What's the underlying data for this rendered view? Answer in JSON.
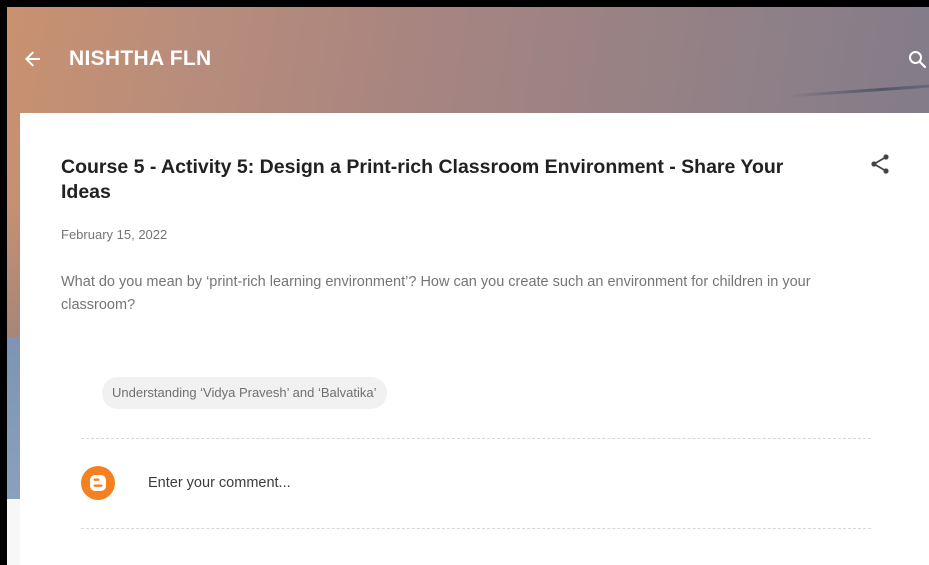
{
  "header": {
    "site_title": "NISHTHA FLN",
    "back_icon": "arrow-left-icon",
    "search_icon": "search-icon"
  },
  "post": {
    "title": "Course 5 - Activity 5: Design a Print-rich Classroom Environment - Share Your Ideas",
    "date": "February 15, 2022",
    "body": "What do you mean by ‘print-rich learning environment’? How can you create such an environment for children in your classroom?",
    "share_icon": "share-icon",
    "labels": [
      "Understanding ‘Vidya Pravesh’ and ‘Balvatika’"
    ]
  },
  "comments": {
    "placeholder": "Enter your comment...",
    "avatar_icon": "blogger-icon",
    "avatar_color": "#f48120"
  },
  "colors": {
    "title_text": "#212121",
    "meta_text": "#757575",
    "chip_bg": "#f1f1f1"
  }
}
